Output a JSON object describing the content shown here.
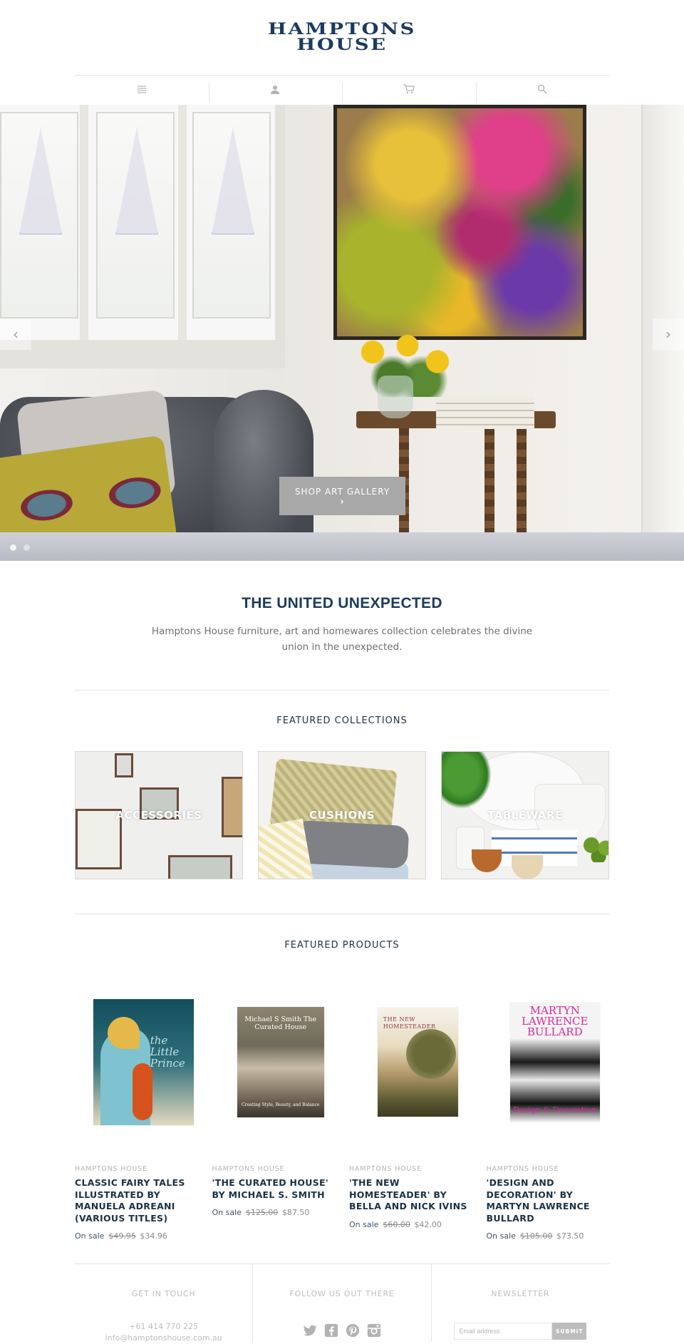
{
  "header": {
    "logo_line1": "HAMPTONS",
    "logo_line2": "HOUSE",
    "nav": [
      {
        "icon": "menu-icon"
      },
      {
        "icon": "account-icon"
      },
      {
        "icon": "cart-icon"
      },
      {
        "icon": "search-icon"
      }
    ]
  },
  "hero": {
    "cta_label": "SHOP ART GALLERY",
    "cta_chevron": "›",
    "prev_arrow": "‹",
    "next_arrow": "›",
    "slides": 2,
    "active_slide": 1
  },
  "intro": {
    "title": "THE UNITED UNEXPECTED",
    "text": "Hamptons House furniture, art and homewares collection celebrates the divine union in the unexpected."
  },
  "collections": {
    "title": "FEATURED COLLECTIONS",
    "items": [
      {
        "label": "ACCESSORIES"
      },
      {
        "label": "CUSHIONS"
      },
      {
        "label": "TABLEWARE"
      }
    ]
  },
  "products": {
    "title": "FEATURED PRODUCTS",
    "items": [
      {
        "vendor": "HAMPTONS HOUSE",
        "name": "CLASSIC FAIRY TALES ILLUSTRATED BY MANUELA ADREANI (VARIOUS TITLES)",
        "sale_label": "On sale",
        "old_price": "$49.95",
        "price": "$34.96",
        "cover_text": "the Little Prince"
      },
      {
        "vendor": "HAMPTONS HOUSE",
        "name": "'THE CURATED HOUSE' BY MICHAEL S. SMITH",
        "sale_label": "On sale",
        "old_price": "$125.00",
        "price": "$87.50",
        "cover_text": "Michael S Smith The Curated House",
        "cover_subtext": "Creating Style, Beauty, and Balance"
      },
      {
        "vendor": "HAMPTONS HOUSE",
        "name": "'THE NEW HOMESTEADER' BY BELLA AND NICK IVINS",
        "sale_label": "On sale",
        "old_price": "$60.00",
        "price": "$42.00",
        "cover_text": "THE NEW HOMESTEADER"
      },
      {
        "vendor": "HAMPTONS HOUSE",
        "name": "'DESIGN AND DECORATION' BY MARTYN LAWRENCE BULLARD",
        "sale_label": "On sale",
        "old_price": "$105.00",
        "price": "$73.50",
        "cover_text": "MARTYN LAWRENCE BULLARD",
        "cover_subtext": "Design & Decoration"
      }
    ]
  },
  "footer": {
    "contact_title": "GET IN TOUCH",
    "phone": "+61 414 770 225",
    "email": "info@hamptonshouse.com.au",
    "social_title": "FOLLOW US OUT THERE",
    "socials": [
      "twitter-icon",
      "facebook-icon",
      "pinterest-icon",
      "instagram-icon"
    ],
    "newsletter_title": "NEWSLETTER",
    "email_placeholder": "Email address",
    "submit_label": "SUBMIT"
  },
  "colors": {
    "brand_navy": "#1c3a5e",
    "cta_grey": "#a8a8a8",
    "muted_text": "#bdbdbd"
  }
}
